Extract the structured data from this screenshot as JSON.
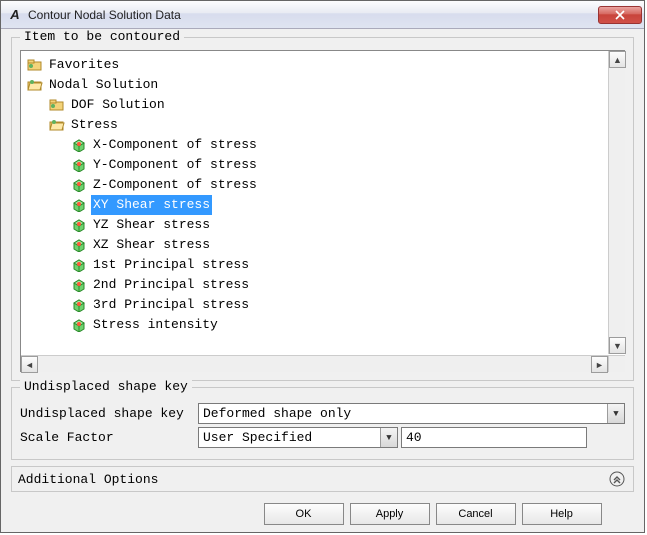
{
  "window": {
    "title": "Contour Nodal Solution Data"
  },
  "group1": {
    "legend": "Item to be contoured"
  },
  "tree": {
    "n0": "Favorites",
    "n1": "Nodal Solution",
    "n2": "DOF Solution",
    "n3": "Stress",
    "n4": "X-Component of stress",
    "n5": "Y-Component of stress",
    "n6": "Z-Component of stress",
    "n7": "XY Shear stress",
    "n8": "YZ Shear stress",
    "n9": "XZ Shear stress",
    "n10": "1st Principal stress",
    "n11": "2nd Principal stress",
    "n12": "3rd Principal stress",
    "n13": "Stress intensity"
  },
  "group2": {
    "legend": "Undisplaced shape key",
    "label1": "Undisplaced shape key",
    "value1": "Deformed shape only",
    "label2": "Scale Factor",
    "value2": "User Specified",
    "value2b": "40"
  },
  "addopt": "Additional Options",
  "buttons": {
    "ok": "OK",
    "apply": "Apply",
    "cancel": "Cancel",
    "help": "Help"
  }
}
